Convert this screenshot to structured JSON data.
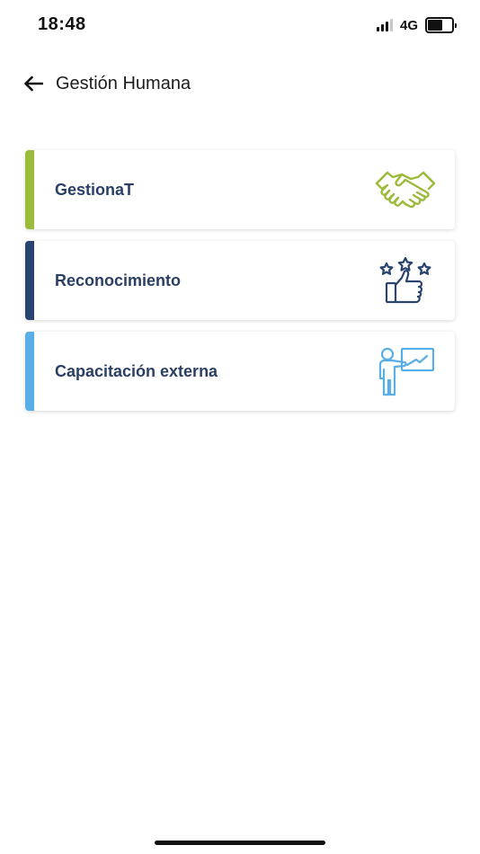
{
  "status_bar": {
    "time": "18:48",
    "network": "4G",
    "battery_level": 0.6
  },
  "header": {
    "title": "Gestión Humana",
    "back_icon": "arrow-left-icon"
  },
  "menu": {
    "items": [
      {
        "label": "GestionaT",
        "accent_color": "#9bbb3b",
        "icon": "handshake-icon"
      },
      {
        "label": "Reconocimiento",
        "accent_color": "#2a4470",
        "icon": "thumbs-up-stars-icon"
      },
      {
        "label": "Capacitación externa",
        "accent_color": "#5aaee8",
        "icon": "presenter-board-icon"
      }
    ]
  }
}
